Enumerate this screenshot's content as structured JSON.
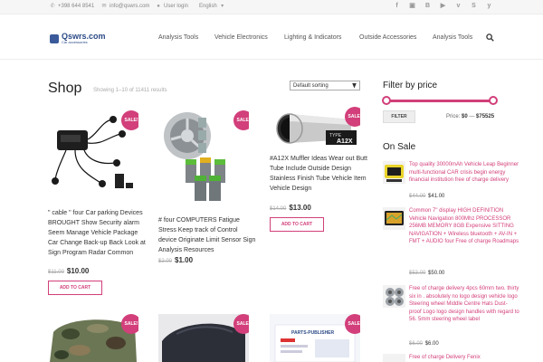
{
  "topbar": {
    "phone": "+398 644 8541",
    "email": "info@qswrs.com",
    "login": "User login",
    "language": "English",
    "social_icons": [
      "facebook-icon",
      "instagram-icon",
      "behance-icon",
      "youtube-icon",
      "vk-icon",
      "skype-icon",
      "yelp-icon"
    ]
  },
  "header": {
    "logo_name": "Qswrs.com",
    "logo_sub": "Car accessories",
    "nav": [
      "Analysis Tools",
      "Vehicle Electronics",
      "Lighting & Indicators",
      "Outside Accessories",
      "Analysis Tools"
    ]
  },
  "shop": {
    "title": "Shop",
    "result_count": "Showing 1–10 of 11411 results",
    "sort_value": "Default sorting",
    "sale_label": "SALE!",
    "add_to_cart": "ADD TO CART",
    "products": [
      {
        "title": "\" cable \" four Car parking Devices BROUGHT Show Security alarm Seem Manage Vehicle Package Car Change Back-up Back Look at Sign Program Radar Common",
        "old_price": "$11.00",
        "price": "$10.00"
      },
      {
        "title": "# four COMPUTERS Fatigue Stress Keep track of Control device Originate Limit Sensor Sign Analysis Resources",
        "old_price": "$2.00",
        "price": "$1.00"
      },
      {
        "title": "#A12X Muffler Ideas Wear out Butt Tube Include Outside Design Stainless Finish Tube Vehicle Item Vehicle Design",
        "old_price": "$14.00",
        "price": "$13.00",
        "image_text": "A12X",
        "image_text_small": "TYPE"
      },
      {
        "title": ""
      },
      {
        "title": ""
      },
      {
        "title": "",
        "image_text": "PARTS-PUBLISHER"
      }
    ]
  },
  "sidebar": {
    "filter_title": "Filter by price",
    "filter_button": "FILTER",
    "price_label": "Price:",
    "price_min": "$0",
    "price_max": "$75525",
    "price_separator": "—",
    "price_slider_min_fraction": 0.0,
    "price_slider_max_fraction": 1.0,
    "onsale_title": "On Sale",
    "onsale": [
      {
        "title": "Top quality 30000mAh Vehicle Leap Beginner multi-functional CAR crisis begin energy financial institution free of charge delivery",
        "old_price": "$44.00",
        "price": "$41.00"
      },
      {
        "title": "Common 7\" display HIGH DEFINITION Vehicle Navigation 800Mhz PROCESSOR 256MB MEMORY 8GB Expensive SITTING NAVIGATION + Wireless bluetooth + AV-IN + FMT + AUDIO four Free of charge Roadmaps",
        "old_price": "$53.00",
        "price": "$50.00"
      },
      {
        "title": "Free of charge delivery 4pcs 60mm two. thirty six in . absolutely no logo design vehicle logo Steering wheel Middle Centre Hats Dust-proof Logo logo design handles with regard to 56. 5mm steering wheel label",
        "old_price": "$6.00",
        "price": "$6.00"
      },
      {
        "title": "Free of charge Delivery Fenix"
      }
    ]
  },
  "colors": {
    "accent": "#d23f7a",
    "brand": "#2b4a86"
  }
}
